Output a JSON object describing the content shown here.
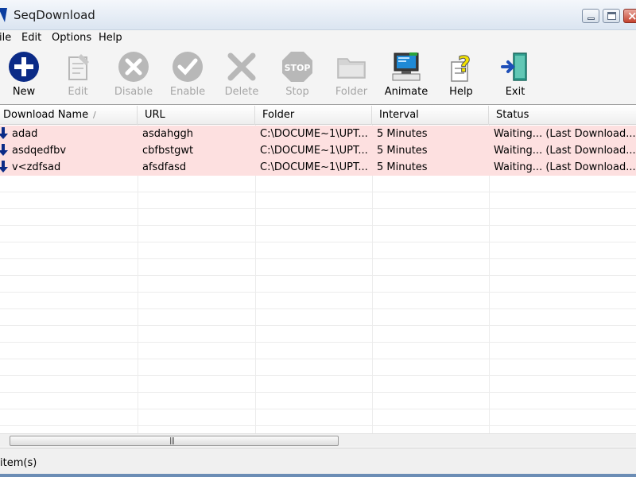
{
  "window": {
    "title": "SeqDownload"
  },
  "menu": [
    "ile",
    "Edit",
    "Options",
    "Help"
  ],
  "toolbar": [
    {
      "label": "New",
      "icon": "new-plus-icon",
      "enabled": true
    },
    {
      "label": "Edit",
      "icon": "edit-document-icon",
      "enabled": false
    },
    {
      "label": "Disable",
      "icon": "disable-x-icon",
      "enabled": false
    },
    {
      "label": "Enable",
      "icon": "enable-check-icon",
      "enabled": false
    },
    {
      "label": "Delete",
      "icon": "delete-x-icon",
      "enabled": false
    },
    {
      "label": "Stop",
      "icon": "stop-sign-icon",
      "enabled": false
    },
    {
      "label": "Folder",
      "icon": "folder-icon",
      "enabled": false
    },
    {
      "label": "Animate",
      "icon": "animate-computer-icon",
      "enabled": true
    },
    {
      "label": "Help",
      "icon": "help-question-icon",
      "enabled": true
    },
    {
      "label": "Exit",
      "icon": "exit-door-icon",
      "enabled": true
    }
  ],
  "table": {
    "columns": [
      "Download Name",
      "URL",
      "Folder",
      "Interval",
      "Status"
    ],
    "rows": [
      {
        "name": "adad",
        "url": "asdahggh",
        "folder": "C:\\DOCUME~1\\UPT...",
        "interval": "5 Minutes",
        "status": "Waiting... (Last Download..."
      },
      {
        "name": "asdqedfbv",
        "url": "cbfbstgwt",
        "folder": "C:\\DOCUME~1\\UPT...",
        "interval": "5 Minutes",
        "status": "Waiting... (Last Download..."
      },
      {
        "name": "v<zdfsad",
        "url": "afsdfasd",
        "folder": "C:\\DOCUME~1\\UPT...",
        "interval": "5 Minutes",
        "status": "Waiting... (Last Download..."
      }
    ]
  },
  "status": {
    "text": "item(s)"
  },
  "colors": {
    "row_highlight": "#fde0e0",
    "new_icon": "#0b2b87",
    "disabled_icon": "#b8b8b8"
  }
}
